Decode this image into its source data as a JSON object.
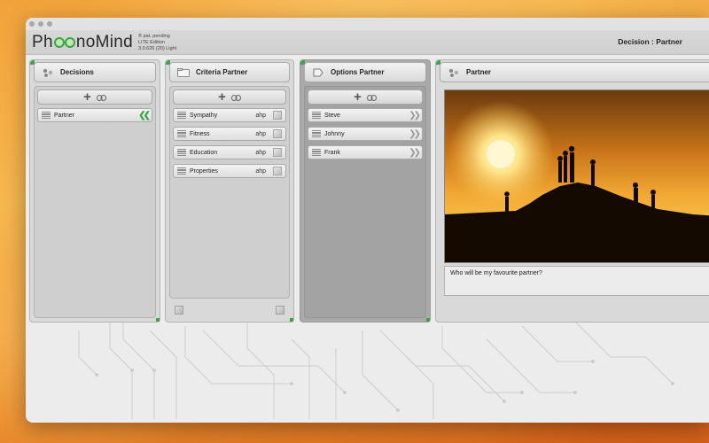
{
  "app": {
    "logo_left": "Ph",
    "logo_right": "noMind",
    "logo_meta_line1": "® pat. pending",
    "logo_meta_line2": "LITE Edition",
    "logo_meta_line3": "3.0.626 (20)  Light",
    "header_title": "Decision : Partner"
  },
  "decisions": {
    "title": "Decisions",
    "items": [
      {
        "label": "Partner"
      }
    ]
  },
  "criteria": {
    "title": "Criteria Partner",
    "items": [
      {
        "label": "Sympathy",
        "method": "ahp"
      },
      {
        "label": "Fitness",
        "method": "ahp"
      },
      {
        "label": "Education",
        "method": "ahp"
      },
      {
        "label": "Properties",
        "method": "ahp"
      }
    ]
  },
  "options": {
    "title": "Options Partner",
    "items": [
      {
        "label": "Steve"
      },
      {
        "label": "Johnny"
      },
      {
        "label": "Frank"
      }
    ]
  },
  "detail": {
    "title": "Partner",
    "description": "Who will be my favourite partner?"
  },
  "colors": {
    "accent_green": "#3aa543",
    "window_bg": "#ececec",
    "options_panel_bg": "#a9a9a9"
  }
}
